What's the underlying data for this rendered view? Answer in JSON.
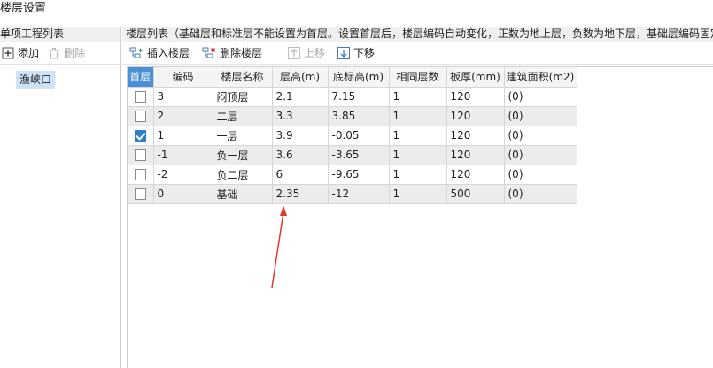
{
  "window": {
    "title": "楼层设置"
  },
  "left_panel": {
    "header": "单项工程列表",
    "add_label": "添加",
    "delete_label": "删除",
    "selected_item": "渔峡口"
  },
  "right_panel": {
    "header": "楼层列表（基础层和标准层不能设置为首层。设置首层后，楼层编码自动变化，正数为地上层，负数为地下层，基础层编码固定",
    "toolbar": {
      "insert_label": "插入楼层",
      "delete_label": "删除楼层",
      "move_up_label": "上移",
      "move_down_label": "下移"
    },
    "columns": [
      "首层",
      "编码",
      "楼层名称",
      "层高(m)",
      "底标高(m)",
      "相同层数",
      "板厚(mm)",
      "建筑面积(m2)"
    ],
    "rows": [
      {
        "first": false,
        "code": "3",
        "name": "闷顶层",
        "height": "2.1",
        "bottom": "7.15",
        "same": "1",
        "thickness": "120",
        "area": "(0)"
      },
      {
        "first": false,
        "code": "2",
        "name": "二层",
        "height": "3.3",
        "bottom": "3.85",
        "same": "1",
        "thickness": "120",
        "area": "(0)"
      },
      {
        "first": true,
        "code": "1",
        "name": "一层",
        "height": "3.9",
        "bottom": "-0.05",
        "same": "1",
        "thickness": "120",
        "area": "(0)"
      },
      {
        "first": false,
        "code": "-1",
        "name": "负一层",
        "height": "3.6",
        "bottom": "-3.65",
        "same": "1",
        "thickness": "120",
        "area": "(0)"
      },
      {
        "first": false,
        "code": "-2",
        "name": "负二层",
        "height": "6",
        "bottom": "-9.65",
        "same": "1",
        "thickness": "120",
        "area": "(0)"
      },
      {
        "first": false,
        "code": "0",
        "name": "基础",
        "height": "2.35",
        "bottom": "-12",
        "same": "1",
        "thickness": "500",
        "area": "(0)"
      }
    ]
  },
  "colors": {
    "first_header_bg": "#4a90d9",
    "selection_bg": "#cfe3f7",
    "annotation_arrow": "#e03a2f"
  }
}
